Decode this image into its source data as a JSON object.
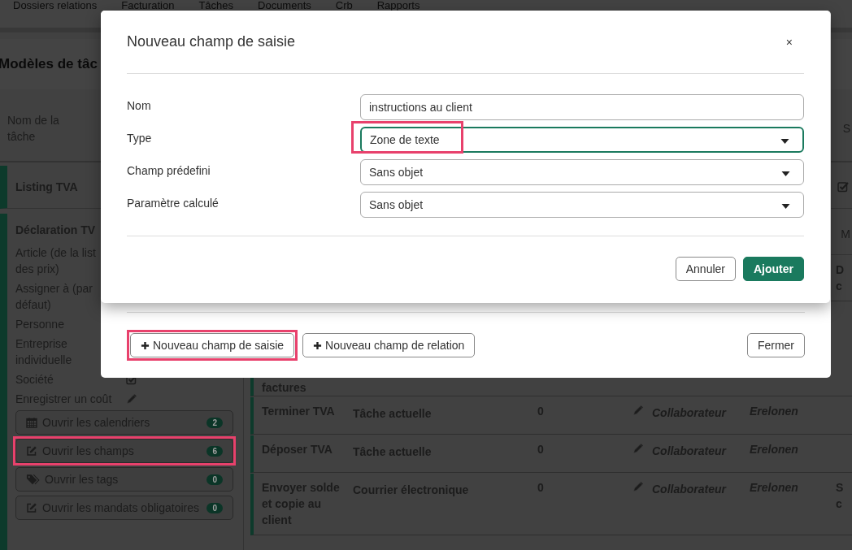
{
  "nav": [
    "Dossiers relations",
    "Facturation",
    "Tâches",
    "Documents",
    "Crb",
    "Rapports"
  ],
  "page_title": "Modèles de tâc",
  "table_header": {
    "name": "Nom de la tâche",
    "edge": "S"
  },
  "listing_row": {
    "name": "Listing TVA",
    "checked": true
  },
  "expanded_task": {
    "name": "Déclaration TV",
    "properties": [
      {
        "label": "Article (de la list des prix)",
        "kind": "text"
      },
      {
        "label": "Assigner à (par défaut)",
        "kind": "text"
      },
      {
        "label": "Personne",
        "kind": "text"
      },
      {
        "label": "Entreprise individuelle",
        "kind": "text"
      },
      {
        "label": "Société",
        "kind": "check",
        "checked": true
      },
      {
        "label": "Enregistrer un coût",
        "kind": "edit"
      }
    ],
    "actions": [
      {
        "kind": "calendar",
        "label": "Ouvrir les calendriers",
        "count": "2",
        "highlighted": false
      },
      {
        "kind": "edit",
        "label": "Ouvrir les champs",
        "count": "6",
        "highlighted": true
      },
      {
        "kind": "tags",
        "label": "Ouvrir les tags",
        "count": "0",
        "highlighted": false
      },
      {
        "kind": "edit",
        "label": "Ouvrir les mandats obligatoires",
        "count": "0",
        "highlighted": false
      }
    ],
    "subtable_header_edge": "M",
    "subtasks": [
      {
        "edge": "D c"
      },
      {
        "name": "factures"
      },
      {
        "name": "Terminer TVA",
        "type": "Tâche actuelle",
        "count": "0",
        "role": "Collaborateur",
        "assignee": "Erelonen"
      },
      {
        "name": "Déposer TVA",
        "type": "Tâche actuelle",
        "count": "0",
        "role": "Collaborateur",
        "assignee": "Erelonen"
      },
      {
        "name": "Envoyer solde et copie au client",
        "type": "Courrier électronique",
        "count": "0",
        "role": "Collaborateur",
        "assignee": "Erelonen",
        "edge": "S c"
      }
    ]
  },
  "fields_dialog": {
    "buttons": [
      {
        "label": "Nouveau champ de saisie",
        "highlighted": true
      },
      {
        "label": "Nouveau champ de relation",
        "highlighted": false
      }
    ],
    "close_button": "Fermer"
  },
  "new_field_dialog": {
    "title": "Nouveau champ de saisie",
    "close": "×",
    "fields": [
      {
        "label": "Nom",
        "kind": "input",
        "value": "instructions au client",
        "focused": false,
        "highlighted": false
      },
      {
        "label": "Type",
        "kind": "select",
        "value": "Zone de texte",
        "focused": true,
        "highlighted": true
      },
      {
        "label": "Champ prédefini",
        "kind": "select",
        "value": "Sans objet",
        "focused": false,
        "highlighted": false
      },
      {
        "label": "Paramètre calculé",
        "kind": "select",
        "value": "Sans objet",
        "focused": false,
        "highlighted": false
      }
    ],
    "cancel": "Annuler",
    "submit": "Ajouter"
  }
}
